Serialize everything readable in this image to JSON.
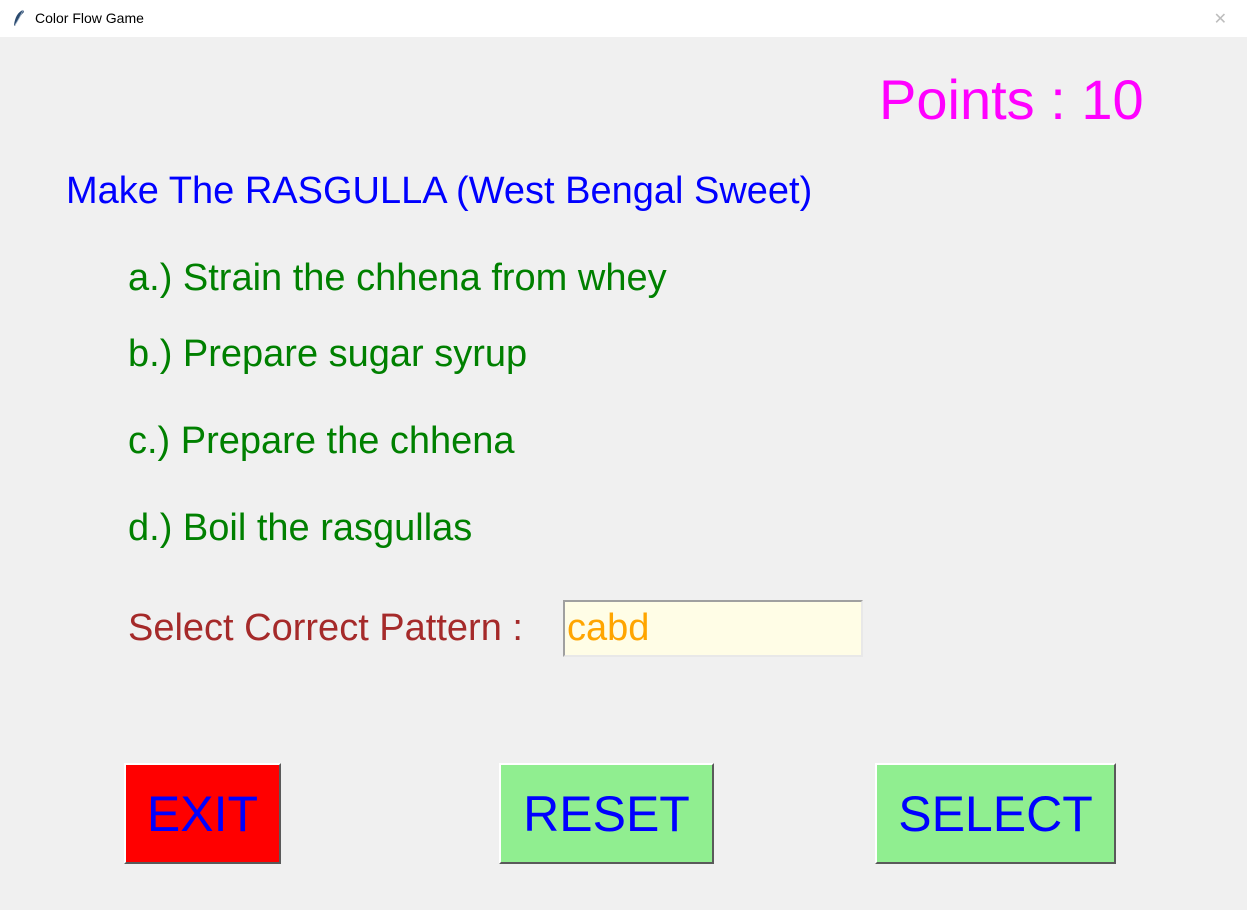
{
  "window": {
    "title": "Color Flow Game",
    "close_glyph": "✕",
    "app_icon": "feather-icon"
  },
  "points": {
    "text": "Points : 10",
    "color": "#ff00ff"
  },
  "question": {
    "text": "Make The RASGULLA (West Bengal Sweet)",
    "color": "#0000ff"
  },
  "options": [
    {
      "text": "a.) Strain the chhena from whey"
    },
    {
      "text": "b.) Prepare sugar syrup"
    },
    {
      "text": "c.) Prepare the chhena"
    },
    {
      "text": "d.) Boil the rasgullas"
    }
  ],
  "option_color": "#008000",
  "pattern": {
    "label": "Select Correct Pattern :",
    "label_color": "#a52a2a",
    "value": "cabd",
    "value_color": "#ffa500",
    "field_bg": "#fffde6"
  },
  "buttons": {
    "exit": {
      "label": "EXIT",
      "bg": "#ff0000",
      "fg": "#0000ff"
    },
    "reset": {
      "label": "RESET",
      "bg": "#90ee90",
      "fg": "#0000ff"
    },
    "select": {
      "label": "SELECT",
      "bg": "#90ee90",
      "fg": "#0000ff"
    }
  }
}
